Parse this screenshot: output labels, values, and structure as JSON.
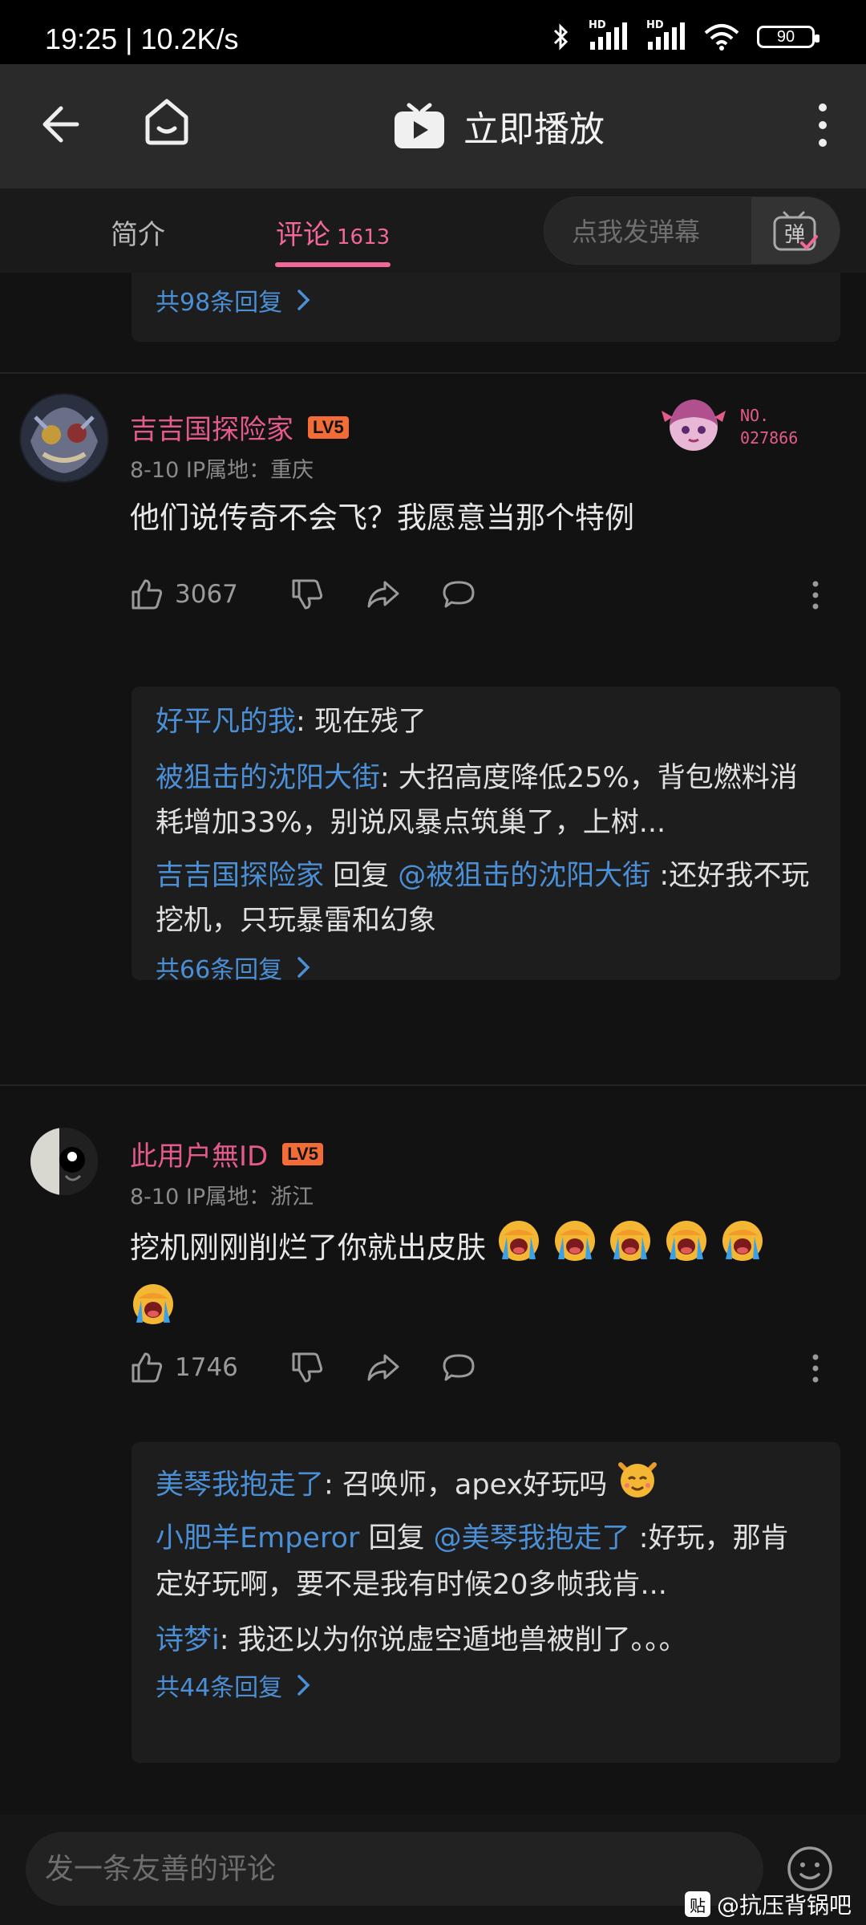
{
  "status_bar": {
    "time": "19:25 | 10.2K/s",
    "battery": "90",
    "hd1": "HD",
    "hd2": "HD"
  },
  "header": {
    "title": "立即播放"
  },
  "tabs": {
    "intro": "简介",
    "comments": "评论",
    "comments_count": "1613",
    "danmaku_placeholder": "点我发弹幕",
    "danmaku_btn": "弹"
  },
  "top_partial": {
    "more_replies": "共98条回复"
  },
  "comments": [
    {
      "user": "吉吉国探险家",
      "level": "LV5",
      "meta": "8-10  IP属地：重庆",
      "text": "他们说传奇不会飞？我愿意当那个特例",
      "likes": "3067",
      "badge_line1": "NO.",
      "badge_line2": "027866",
      "replies": [
        {
          "name": "好平凡的我",
          "text": ": 现在残了"
        },
        {
          "name": "被狙击的沈阳大街",
          "text": ": 大招高度降低25%，背包燃料消耗增加33%，别说风暴点筑巢了，上树..."
        },
        {
          "name": "吉吉国探险家",
          "reply_word": " 回复 ",
          "target": "@被狙击的沈阳大街",
          "text": " :还好我不玩挖机，只玩暴雷和幻象"
        }
      ],
      "more_replies": "共66条回复"
    },
    {
      "user": "此用户無ID",
      "level": "LV5",
      "meta": "8-10  IP属地：浙江",
      "text": "挖机刚刚削烂了你就出皮肤",
      "likes": "1746",
      "replies": [
        {
          "name": "美琴我抱走了",
          "text": ": 召唤师，apex好玩吗"
        },
        {
          "name": "小肥羊Emperor",
          "reply_word": " 回复 ",
          "target": "@美琴我抱走了",
          "text": " :好玩，那肯定好玩啊，要不是我有时候20多帧我肯..."
        },
        {
          "name": "诗梦i",
          "text": ": 我还以为你说虚空遁地兽被削了。。。"
        }
      ],
      "more_replies": "共44条回复"
    }
  ],
  "bottom": {
    "placeholder": "发一条友善的评论",
    "watermark_logo": "贴",
    "watermark": "@抗压背锅吧"
  },
  "colors": {
    "accent_pink": "#f2679a",
    "link_blue": "#4b8fd6",
    "level_orange": "#f26c37"
  }
}
